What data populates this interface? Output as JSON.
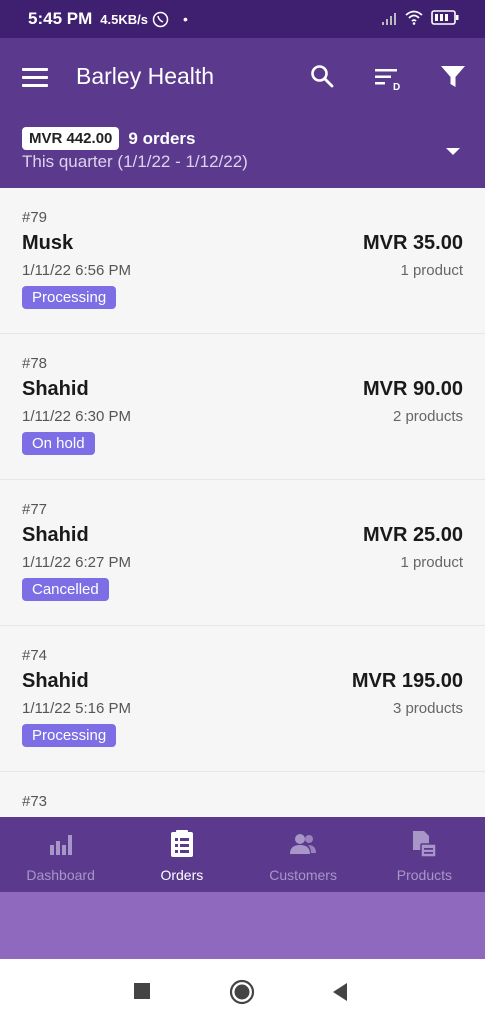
{
  "status_bar": {
    "time": "5:45 PM",
    "speed": "4.5KB/s",
    "dot": "•"
  },
  "app_bar": {
    "title": "Barley Health",
    "amount": "MVR 442.00",
    "order_count": "9 orders",
    "date_range": "This quarter (1/1/22 - 1/12/22)"
  },
  "orders": [
    {
      "number": "#79",
      "name": "Musk",
      "date": "1/11/22 6:56 PM",
      "status": "Processing",
      "price": "MVR 35.00",
      "products": "1 product"
    },
    {
      "number": "#78",
      "name": "Shahid",
      "date": "1/11/22 6:30 PM",
      "status": "On hold",
      "price": "MVR 90.00",
      "products": "2 products"
    },
    {
      "number": "#77",
      "name": "Shahid",
      "date": "1/11/22 6:27 PM",
      "status": "Cancelled",
      "price": "MVR 25.00",
      "products": "1 product"
    },
    {
      "number": "#74",
      "name": "Shahid",
      "date": "1/11/22 5:16 PM",
      "status": "Processing",
      "price": "MVR 195.00",
      "products": "3 products"
    },
    {
      "number": "#73",
      "name": "",
      "date": "",
      "status": "",
      "price": "",
      "products": ""
    }
  ],
  "bottom_nav": {
    "items": [
      {
        "label": "Dashboard",
        "icon": "bar-chart-icon"
      },
      {
        "label": "Orders",
        "icon": "orders-list-icon",
        "active": true
      },
      {
        "label": "Customers",
        "icon": "customers-icon"
      },
      {
        "label": "Products",
        "icon": "products-icon"
      }
    ]
  },
  "colors": {
    "status_bar": "#3f2070",
    "app_bar": "#5b3a8e",
    "status_badge": "#7d6ee6",
    "band": "#8e69bd"
  }
}
